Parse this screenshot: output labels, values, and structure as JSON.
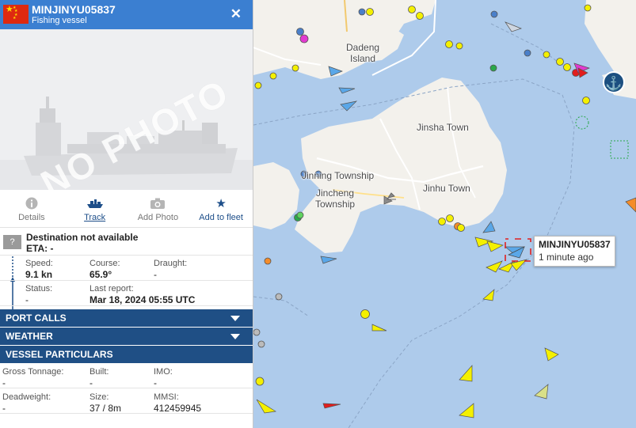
{
  "vessel": {
    "name": "MINJINYU05837",
    "type": "Fishing vessel",
    "close_icon": "close-icon",
    "photo_placeholder": "NO PHOTO"
  },
  "actions": [
    {
      "label": "Details",
      "icon": "info-icon"
    },
    {
      "label": "Track",
      "icon": "ship-icon"
    },
    {
      "label": "Add Photo",
      "icon": "camera-icon"
    },
    {
      "label": "Add to fleet",
      "icon": "star-icon"
    }
  ],
  "destination": {
    "marker": "?",
    "text": "Destination not available",
    "eta": "ETA: -"
  },
  "status_rows": {
    "speed_label": "Speed:",
    "speed": "9.1 kn",
    "course_label": "Course:",
    "course": "65.9°",
    "draught_label": "Draught:",
    "draught": "-",
    "status_label": "Status:",
    "status": "-",
    "report_label": "Last report:",
    "report": "Mar 18, 2024 05:55 UTC"
  },
  "sections": {
    "port_calls": "PORT CALLS",
    "weather": "WEATHER",
    "particulars": "VESSEL PARTICULARS"
  },
  "particulars": {
    "gt_label": "Gross Tonnage:",
    "gt": "-",
    "built_label": "Built:",
    "built": "-",
    "imo_label": "IMO:",
    "imo": "-",
    "dwt_label": "Deadweight:",
    "dwt": "-",
    "size_label": "Size:",
    "size": "37 / 8m",
    "mmsi_label": "MMSI:",
    "mmsi": "412459945"
  },
  "map": {
    "labels": {
      "dadeng": "Dadeng\nIsland",
      "jinsha": "Jinsha Town",
      "jinning": "Jinning Township",
      "jincheng": "Jincheng\nTownship",
      "jinhu": "Jinhu Town"
    },
    "tooltip": {
      "name": "MINJINYU05837",
      "age": "1 minute ago"
    },
    "colors": {
      "water": "#aecbeb",
      "land": "#f3f1ec",
      "vessel_yellow": "#f4f000",
      "vessel_blue": "#5aa7e8",
      "selected": "#e02020"
    }
  }
}
